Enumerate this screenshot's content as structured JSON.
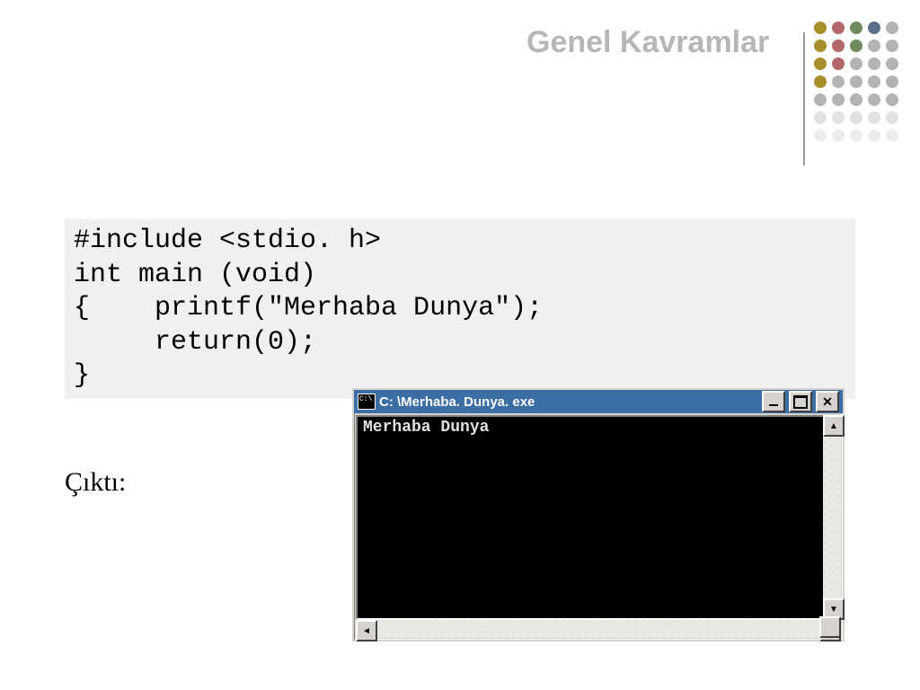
{
  "header": {
    "title": "Genel Kavramlar"
  },
  "decor": {
    "columns": [
      [
        "#a78f2c",
        "#a78f2c",
        "#a78f2c",
        "#a78f2c",
        "#b3b3b3"
      ],
      [
        "#b06868",
        "#b06868",
        "#b06868",
        "#b3b3b3",
        "#b3b3b3"
      ],
      [
        "#6f8a5c",
        "#6f8a5c",
        "#b3b3b3",
        "#b3b3b3",
        "#b3b3b3"
      ],
      [
        "#5c6f8a",
        "#b3b3b3",
        "#b3b3b3",
        "#b3b3b3",
        "#b3b3b3"
      ],
      [
        "#b3b3b3",
        "#b3b3b3",
        "#b3b3b3",
        "#b3b3b3",
        "#b3b3b3"
      ]
    ]
  },
  "code": {
    "line1": "#include <stdio. h>",
    "line2": "int main (void)",
    "line3": "{    printf(\"Merhaba Dunya\");",
    "line4": "     return(0);",
    "line5": "}"
  },
  "output": {
    "label": "Çıktı:"
  },
  "console": {
    "title": "C: \\Merhaba. Dunya. exe",
    "text": "Merhaba Dunya"
  }
}
